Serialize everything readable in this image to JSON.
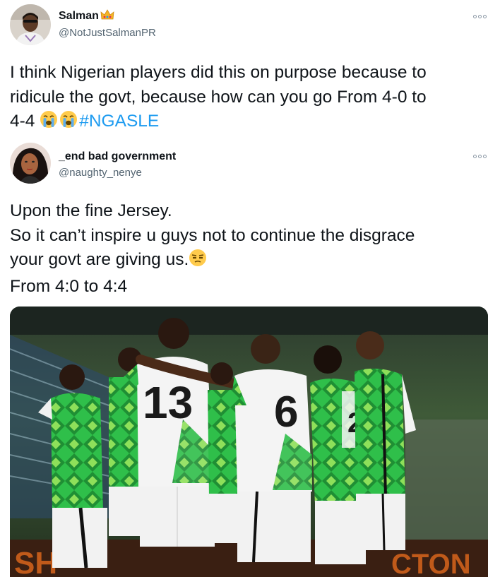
{
  "tweet1": {
    "display_name": "Salman",
    "name_emoji": "crown-emoji",
    "handle": "@NotJustSalmanPR",
    "text_lines": [
      "I think Nigerian players did this on purpose because to",
      "ridicule the govt, because how can you go From 4-0 to",
      "4-4"
    ],
    "emoji": "loudly-crying-face",
    "hashtag": "#NGASLE"
  },
  "tweet2": {
    "display_name": "_end bad government",
    "handle": "@naughty_nenye",
    "text_lines": [
      "Upon the fine Jersey.",
      "So it can’t inspire u guys not to continue the disgrace",
      "your govt are giving us.",
      "From 4:0 to 4:4"
    ],
    "emoji": "unamused-face",
    "media": {
      "jersey_numbers": [
        "13",
        "6",
        "22"
      ],
      "board_left": "SH",
      "board_right": "CTON"
    }
  },
  "colors": {
    "accent": "#1d9bf0",
    "text": "#0f1419",
    "secondary": "#536471",
    "kit_green": "#2fbf4a"
  }
}
